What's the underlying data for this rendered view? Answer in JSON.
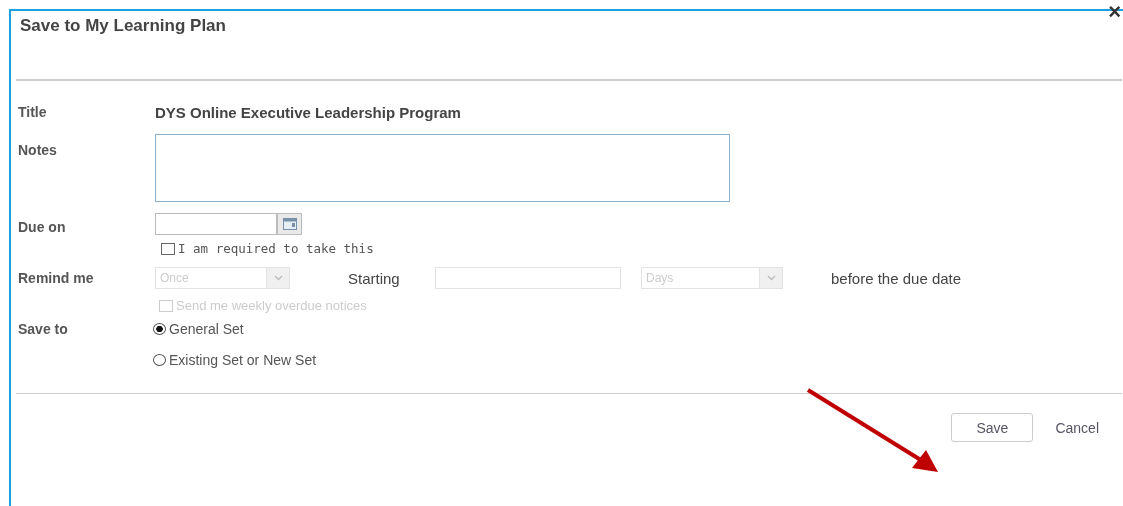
{
  "dialog": {
    "title": "Save to My Learning Plan",
    "close": "×"
  },
  "title_row": {
    "label": "Title",
    "value": "DYS Online Executive Leadership Program"
  },
  "notes": {
    "label": "Notes"
  },
  "due_on": {
    "label": "Due on",
    "required_checkbox": {
      "label": "I am required to take this",
      "checked": false
    }
  },
  "remind_me": {
    "label": "Remind me",
    "disabled": true,
    "frequency": "Once",
    "starting_label": "Starting",
    "unit": "Days",
    "suffix": "before the due date",
    "weekly_notice": {
      "label": "Send me weekly overdue notices",
      "checked": false,
      "disabled": true
    }
  },
  "save_to": {
    "label": "Save to",
    "options": [
      {
        "label": "General Set",
        "selected": true
      },
      {
        "label": "Existing Set or New Set",
        "selected": false
      }
    ]
  },
  "buttons": [
    {
      "label": "Save",
      "kind": "bordered"
    },
    {
      "label": "Cancel",
      "kind": "plain"
    }
  ]
}
